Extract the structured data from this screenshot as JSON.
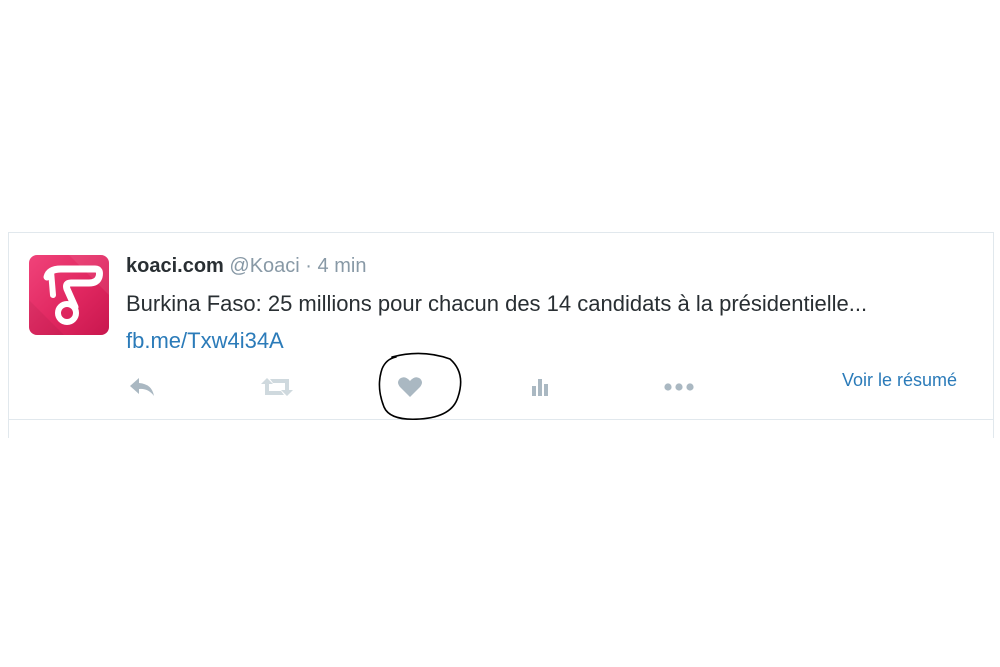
{
  "tweet": {
    "fullname": "koaci.com",
    "handle": "@Koaci",
    "separator": "·",
    "time": "4 min",
    "text": "Burkina Faso: 25 millions pour chacun des 14 candidats à la présidentielle...",
    "link": "fb.me/Txw4i34A",
    "summary_label": "Voir le résumé"
  },
  "actions": {
    "reply_icon": "reply-icon",
    "retweet_icon": "retweet-icon",
    "like_icon": "heart-icon",
    "analytics_icon": "analytics-icon",
    "more_icon": "more-icon"
  },
  "colors": {
    "link": "#2b7bb9",
    "muted": "#8899a6",
    "icon": "#aab8c2",
    "avatar": "#e02760"
  }
}
